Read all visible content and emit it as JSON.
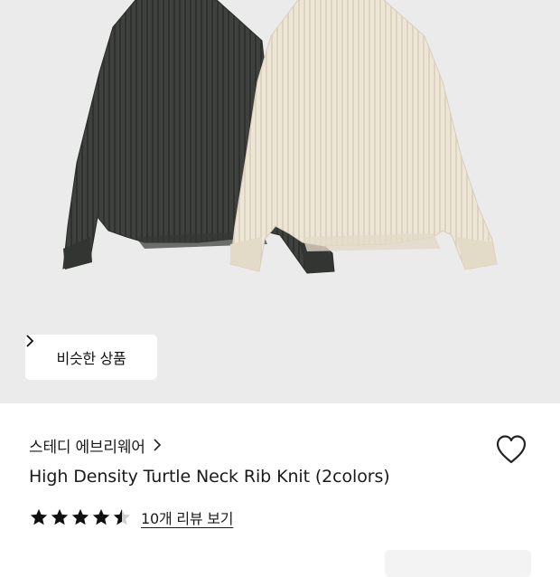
{
  "product_image": {
    "description_icon": "sweater-photo",
    "colors": {
      "dark": "#3e403d",
      "light": "#ece4d4",
      "background": "#ebebeb"
    }
  },
  "similar_button": {
    "label": "비슷한 상품",
    "icon": "chevron-right-icon"
  },
  "brand": {
    "name": "스테디 에브리웨어",
    "icon": "chevron-right-icon"
  },
  "wishlist": {
    "icon": "heart-outline-icon"
  },
  "product": {
    "title": "High Density Turtle Neck Rib Knit (2colors)"
  },
  "rating": {
    "value": 4.5,
    "max": 5,
    "review_link": "10개 리뷰 보기",
    "star_color": "#111111"
  }
}
